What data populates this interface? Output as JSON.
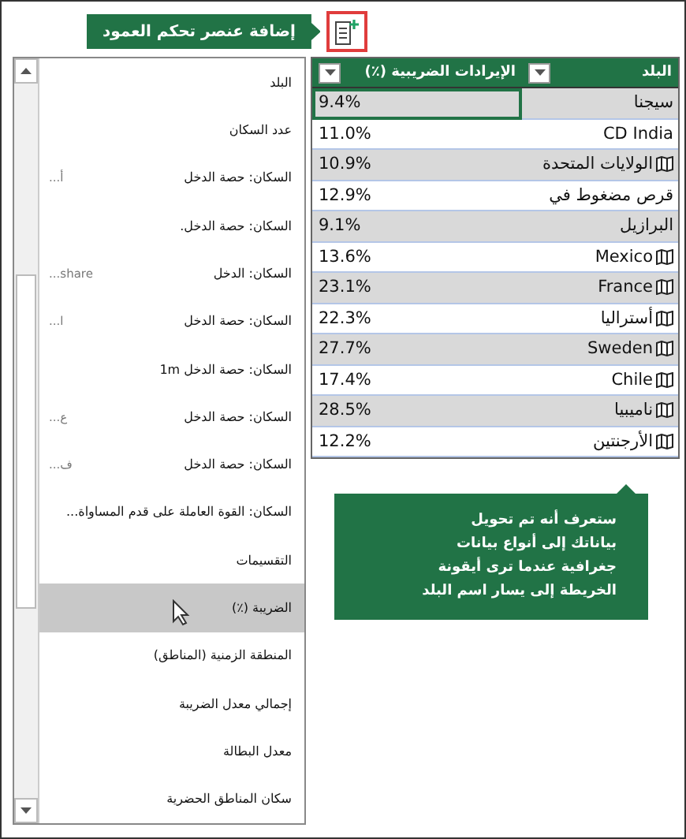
{
  "callout": {
    "text": "إضافة عنصر تحكم العمود"
  },
  "field_list": {
    "items": [
      {
        "label": "البلد",
        "selected": false
      },
      {
        "label": "عدد السكان",
        "selected": false
      },
      {
        "label": "السكان: حصة الدخل",
        "suffix": "أ...",
        "selected": false
      },
      {
        "label": "السكان: حصة الدخل.",
        "selected": false
      },
      {
        "label": "السكان: الدخل",
        "suffix": "share...",
        "selected": false
      },
      {
        "label": "السكان: حصة الدخل",
        "suffix": "ا...",
        "selected": false
      },
      {
        "label": "السكان: حصة الدخل 1m",
        "selected": false
      },
      {
        "label": "السكان: حصة الدخل",
        "suffix": "ع...",
        "selected": false
      },
      {
        "label": "السكان: حصة الدخل",
        "suffix": "ف...",
        "selected": false
      },
      {
        "label": "السكان: القوة العاملة على قدم المساواة...",
        "selected": false
      },
      {
        "label": "التقسيمات",
        "selected": false
      },
      {
        "label": "الضريبة (٪)",
        "selected": true
      },
      {
        "label": "المنطقة الزمنية (المناطق)",
        "selected": false
      },
      {
        "label": "إجمالي معدل الضريبة",
        "selected": false
      },
      {
        "label": "معدل البطالة",
        "selected": false
      },
      {
        "label": "سكان المناطق الحضرية",
        "selected": false
      }
    ]
  },
  "table": {
    "columns": [
      "البلد",
      "الإيرادات الضريبية (٪)"
    ],
    "rows": [
      {
        "country": "سيجنا",
        "value": "9.4%",
        "geo": false,
        "selected": true
      },
      {
        "country": "CD India",
        "value": "11.0%",
        "geo": false,
        "selected": false
      },
      {
        "country": "الولايات المتحدة",
        "value": "10.9%",
        "geo": true,
        "selected": false
      },
      {
        "country": "قرص مضغوط في",
        "value": "12.9%",
        "geo": false,
        "selected": false
      },
      {
        "country": "البرازيل",
        "value": "9.1%",
        "geo": false,
        "selected": false
      },
      {
        "country": "Mexico",
        "value": "13.6%",
        "geo": true,
        "selected": false
      },
      {
        "country": "France",
        "value": "23.1%",
        "geo": true,
        "selected": false
      },
      {
        "country": "أستراليا",
        "value": "22.3%",
        "geo": true,
        "selected": false
      },
      {
        "country": "Sweden",
        "value": "27.7%",
        "geo": true,
        "selected": false
      },
      {
        "country": "Chile",
        "value": "17.4%",
        "geo": true,
        "selected": false
      },
      {
        "country": "ناميبيا",
        "value": "28.5%",
        "geo": true,
        "selected": false
      },
      {
        "country": "الأرجنتين",
        "value": "12.2%",
        "geo": true,
        "selected": false
      }
    ]
  },
  "tip": {
    "text": "ستعرف أنه تم تحويل\nبياناتك إلى أنواع بيانات\nجغرافية عندما ترى أيقونة\nالخريطة إلى يسار اسم البلد"
  }
}
